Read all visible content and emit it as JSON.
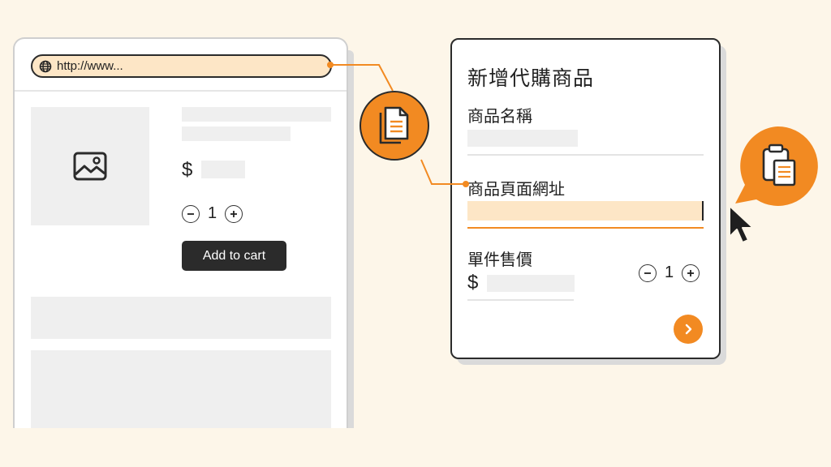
{
  "browser": {
    "url": "http://www...",
    "price_symbol": "$",
    "quantity": "1",
    "add_to_cart_label": "Add to cart"
  },
  "form": {
    "title": "新增代購商品",
    "name_label": "商品名稱",
    "url_label": "商品頁面網址",
    "price_label": "單件售價",
    "price_symbol": "$",
    "quantity": "1"
  },
  "icons": {
    "globe": "globe-icon",
    "image": "image-icon",
    "document": "document-icon",
    "clipboard": "clipboard-icon",
    "next": "chevron-right-icon",
    "cursor": "mouse-cursor-icon"
  },
  "colors": {
    "background": "#fdf6e9",
    "accent": "#f28a22",
    "highlight": "#fde6c6",
    "dark": "#2b2b2b",
    "placeholder": "#efefef"
  }
}
